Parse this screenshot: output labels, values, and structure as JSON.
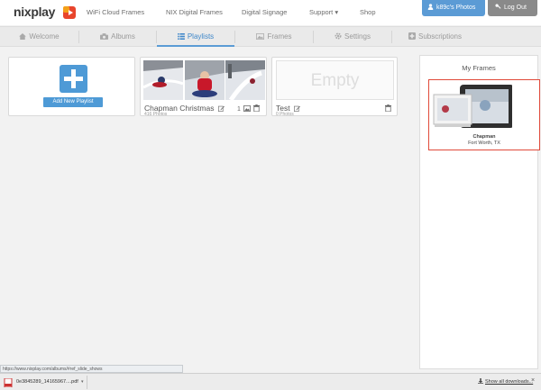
{
  "app": {
    "logo": "nixplay"
  },
  "nav": {
    "links": [
      "WiFi Cloud Frames",
      "NIX Digital Frames",
      "Digital Signage",
      "Support ▾",
      "Shop"
    ],
    "user_button": "k89c's Photos",
    "logout_button": "Log Out"
  },
  "tabs": [
    {
      "label": "Welcome",
      "icon": "home-icon"
    },
    {
      "label": "Albums",
      "icon": "camera-icon"
    },
    {
      "label": "Playlists",
      "icon": "list-icon",
      "active": true
    },
    {
      "label": "Frames",
      "icon": "picture-icon"
    },
    {
      "label": "Settings",
      "icon": "gear-icon"
    },
    {
      "label": "Subscriptions",
      "icon": "plus-square-icon"
    }
  ],
  "playlists": {
    "add_label": "Add New Playlist",
    "items": [
      {
        "name": "Chapman Christmas",
        "count": "416 Photos",
        "frames_count": "1"
      },
      {
        "name": "Test",
        "count": "0 Photos",
        "empty_label": "Empty"
      }
    ]
  },
  "frames_panel": {
    "title": "My Frames",
    "frame": {
      "name": "Chapman",
      "location": "Fort Worth, TX"
    }
  },
  "status_url": "https://www.nixplay.com/albums/#ref_slide_shows",
  "downloads": {
    "file": "0e3845289_14165967....pdf",
    "show_all": "Show all downloads...",
    "close": "×"
  },
  "colors": {
    "accent": "#5b9bd5",
    "frame_highlight": "#e04a3a",
    "logout": "#8a8a8a"
  }
}
